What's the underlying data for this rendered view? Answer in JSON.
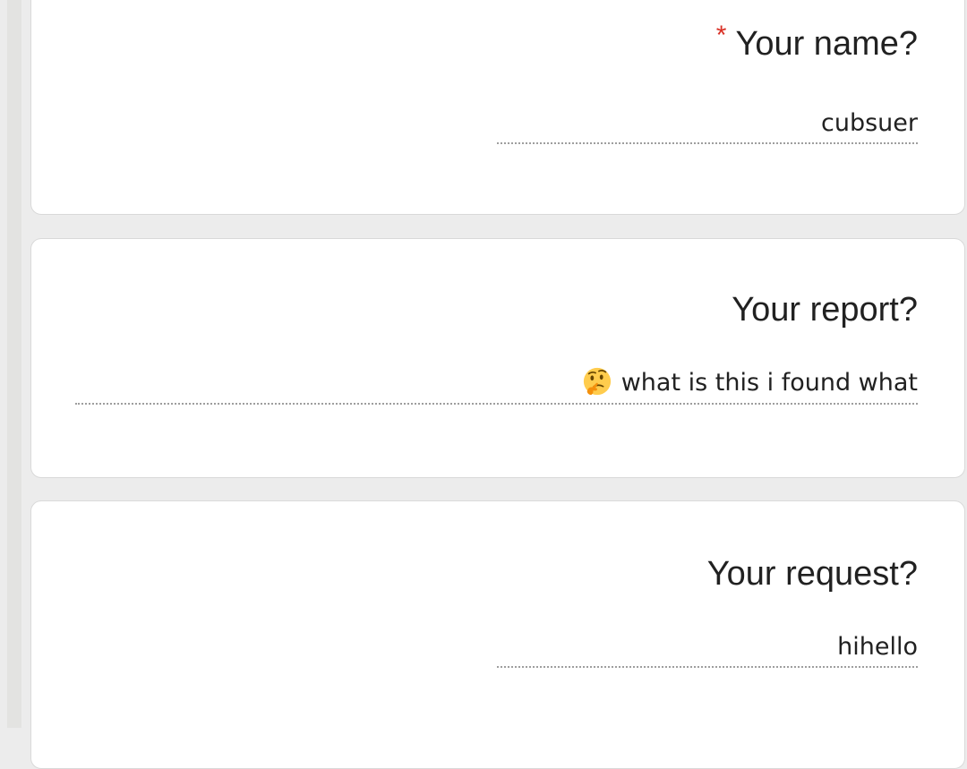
{
  "form": {
    "name_question": {
      "required_mark": "*",
      "label": "Your name?",
      "value": "cubsuer"
    },
    "report_question": {
      "label": "Your report?",
      "emoji": "thinking-face-icon",
      "value": "what is this i found what"
    },
    "request_question": {
      "label": "Your request?",
      "value": "hihello"
    }
  },
  "colors": {
    "required": "#d93025",
    "background": "#ececec",
    "card": "#ffffff"
  }
}
